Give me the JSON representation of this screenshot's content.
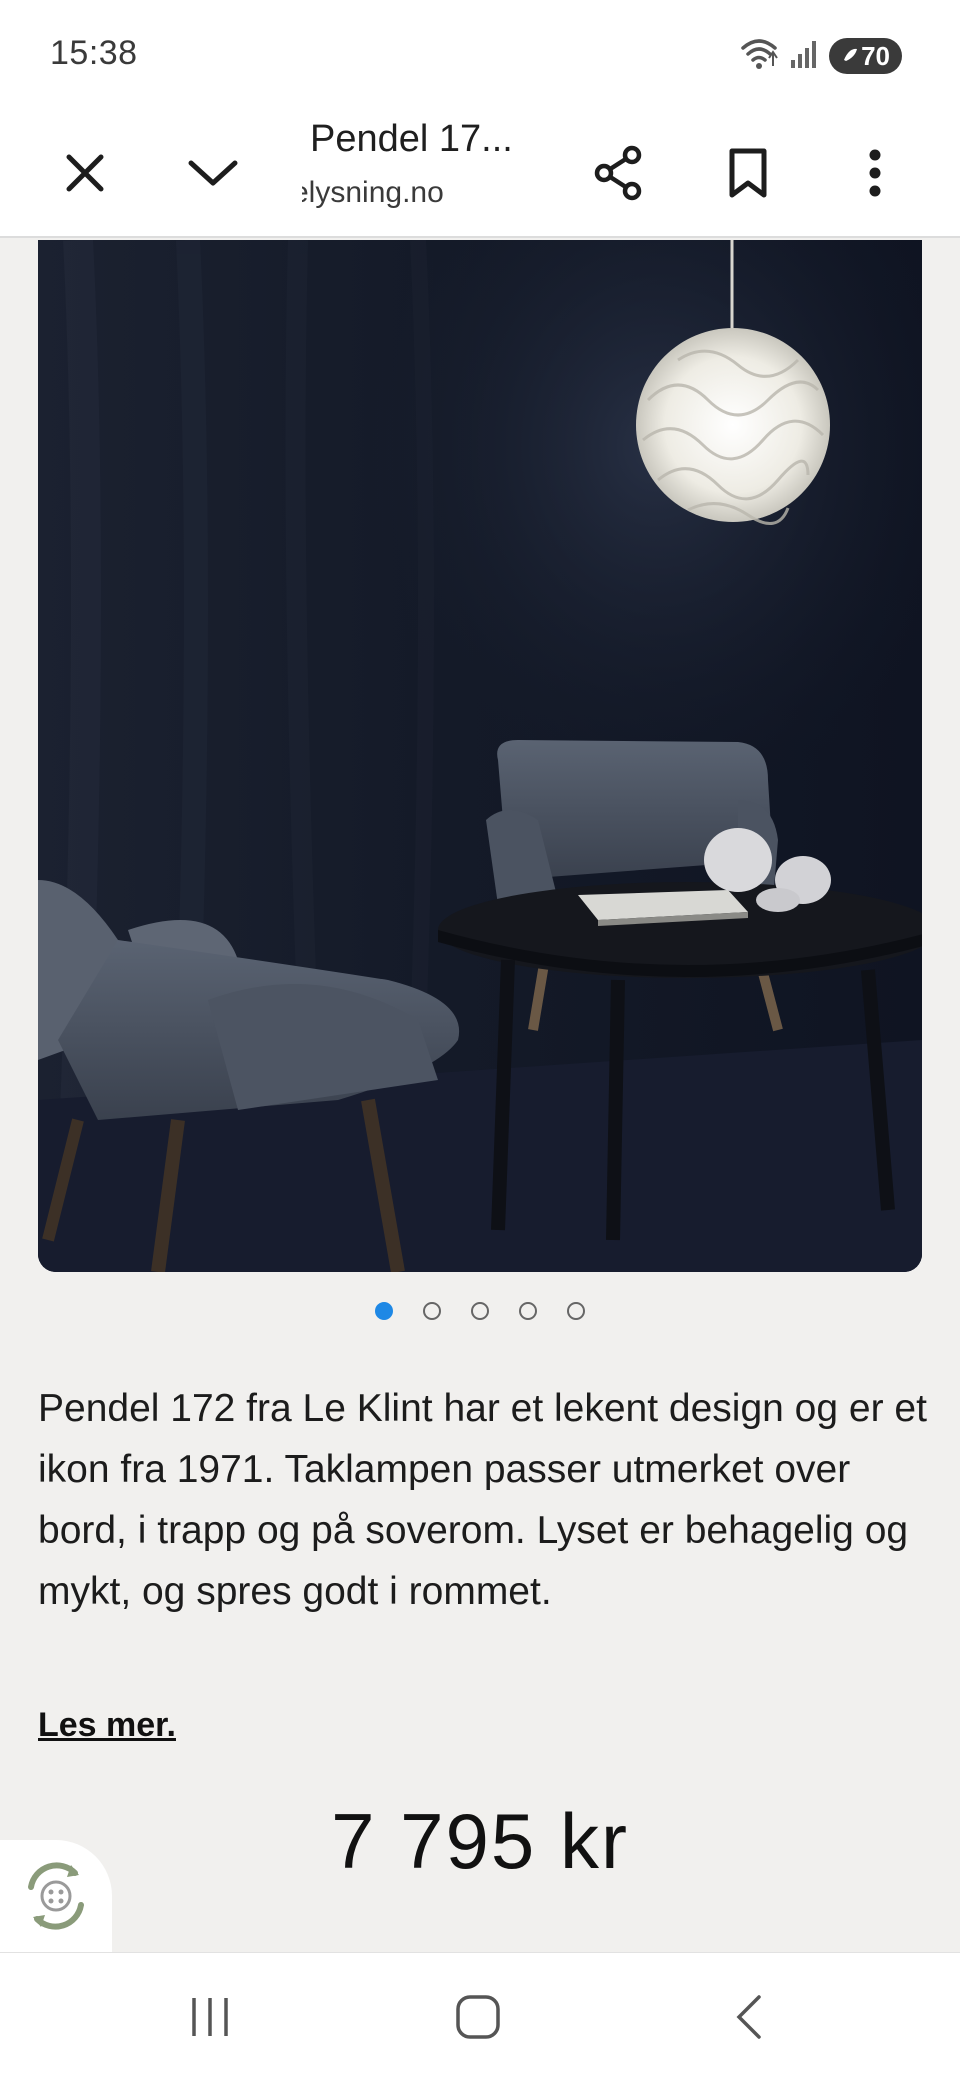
{
  "status_bar": {
    "time": "15:38",
    "battery": "70",
    "icons": [
      "wifi-icon",
      "signal-icon",
      "battery-icon"
    ]
  },
  "toolbar": {
    "title": "Pendel 17...",
    "url": "elysning.no",
    "icons": [
      "close-icon",
      "chevron-down-icon",
      "share-icon",
      "bookmark-icon",
      "more-vert-icon"
    ]
  },
  "carousel": {
    "slide_count": 5,
    "active_index": 0,
    "accent_color": "#1e88e5"
  },
  "product": {
    "description": "Pendel 172 fra Le Klint har et lekent design og er et ikon fra 1971. Taklampen passer utmerket over bord, i trapp og på soverom. Lyset er behagelig og mykt, og spres godt i rommet.",
    "read_more": "Les mer.",
    "price": "7 795 kr"
  },
  "chat_widget": {
    "icon": "chat-widget-icon"
  },
  "nav_bar": {
    "icons": [
      "recents-icon",
      "home-icon",
      "back-icon"
    ]
  }
}
